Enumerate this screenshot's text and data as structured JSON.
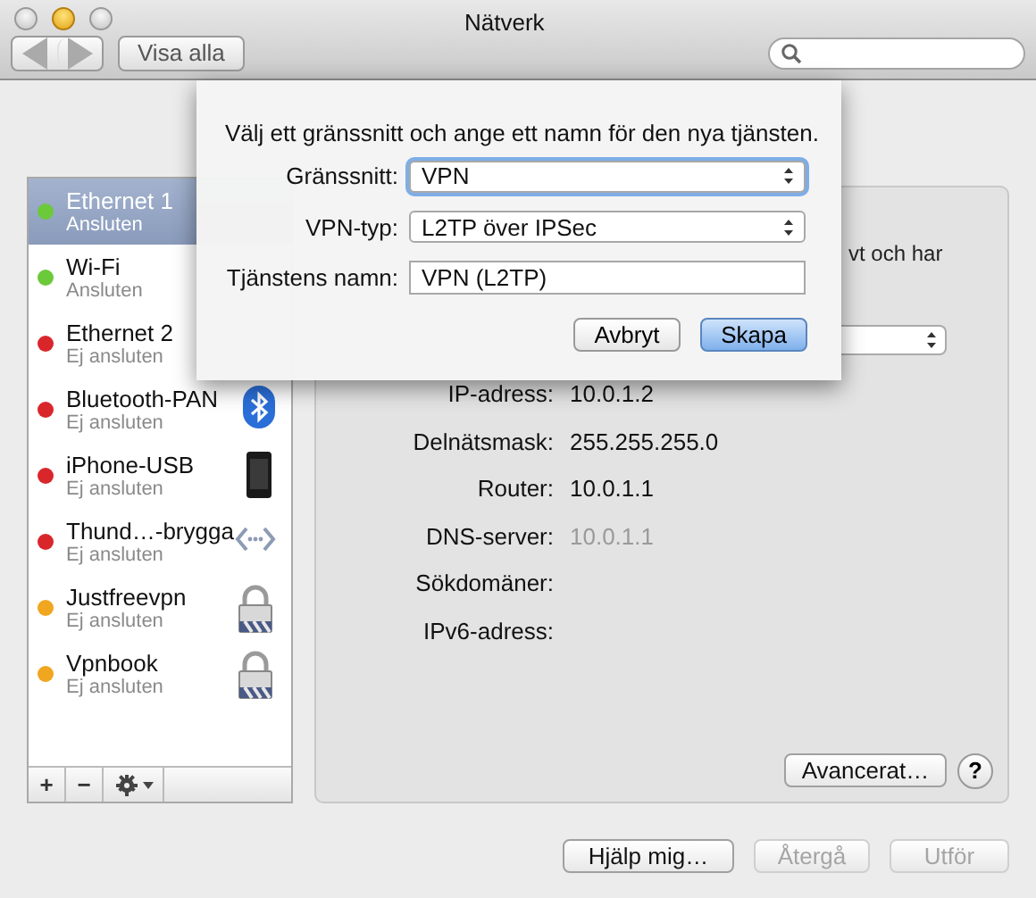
{
  "window": {
    "title": "Nätverk"
  },
  "toolbar": {
    "show_all_button": "Visa alla"
  },
  "services": [
    {
      "name": "Ethernet 1",
      "status": "Ansluten",
      "color": "#6cc93a",
      "selected": true,
      "kind": "none"
    },
    {
      "name": "Wi-Fi",
      "status": "Ansluten",
      "color": "#6cc93a",
      "selected": false,
      "kind": "none"
    },
    {
      "name": "Ethernet 2",
      "status": "Ej ansluten",
      "color": "#d9262b",
      "selected": false,
      "kind": "none"
    },
    {
      "name": "Bluetooth-PAN",
      "status": "Ej ansluten",
      "color": "#d9262b",
      "selected": false,
      "kind": "bluetooth"
    },
    {
      "name": "iPhone-USB",
      "status": "Ej ansluten",
      "color": "#d9262b",
      "selected": false,
      "kind": "phone"
    },
    {
      "name": "Thund…-brygga",
      "status": "Ej ansluten",
      "color": "#d9262b",
      "selected": false,
      "kind": "bridge"
    },
    {
      "name": "Justfreevpn",
      "status": "Ej ansluten",
      "color": "#f0a61f",
      "selected": false,
      "kind": "lock"
    },
    {
      "name": "Vpnbook",
      "status": "Ej ansluten",
      "color": "#f0a61f",
      "selected": false,
      "kind": "lock"
    }
  ],
  "sidebar_tools": [
    "+",
    "−"
  ],
  "details": {
    "note_fragment": "vt och har",
    "fields": [
      {
        "label": "IP-adress:",
        "value": "10.0.1.2",
        "dimmed": false
      },
      {
        "label": "Delnätsmask:",
        "value": "255.255.255.0",
        "dimmed": false
      },
      {
        "label": "Router:",
        "value": "10.0.1.1",
        "dimmed": false
      },
      {
        "label": "DNS-server:",
        "value": "10.0.1.1",
        "dimmed": true
      },
      {
        "label": "Sökdomäner:"
      },
      {
        "label": "IPv6-adress:"
      }
    ],
    "advanced_button": "Avancerat…",
    "help_button": "?"
  },
  "buttons": [
    {
      "label": "Hjälp mig…",
      "disabled": false
    },
    {
      "label": "Återgå",
      "disabled": true
    },
    {
      "label": "Utför",
      "disabled": true
    }
  ],
  "sheet": {
    "prompt": "Välj ett gränssnitt och ange ett namn för den nya tjänsten.",
    "fields": [
      {
        "label": "Gränssnitt:",
        "kind": "popup",
        "value": "VPN",
        "focused": true
      },
      {
        "label": "VPN-typ:",
        "kind": "popup",
        "value": "L2TP över IPSec",
        "focused": false
      },
      {
        "label": "Tjänstens namn:",
        "kind": "text",
        "value": "VPN (L2TP)",
        "focused": false
      }
    ],
    "buttons": [
      {
        "label": "Avbryt",
        "default": false
      },
      {
        "label": "Skapa",
        "default": true
      }
    ]
  }
}
